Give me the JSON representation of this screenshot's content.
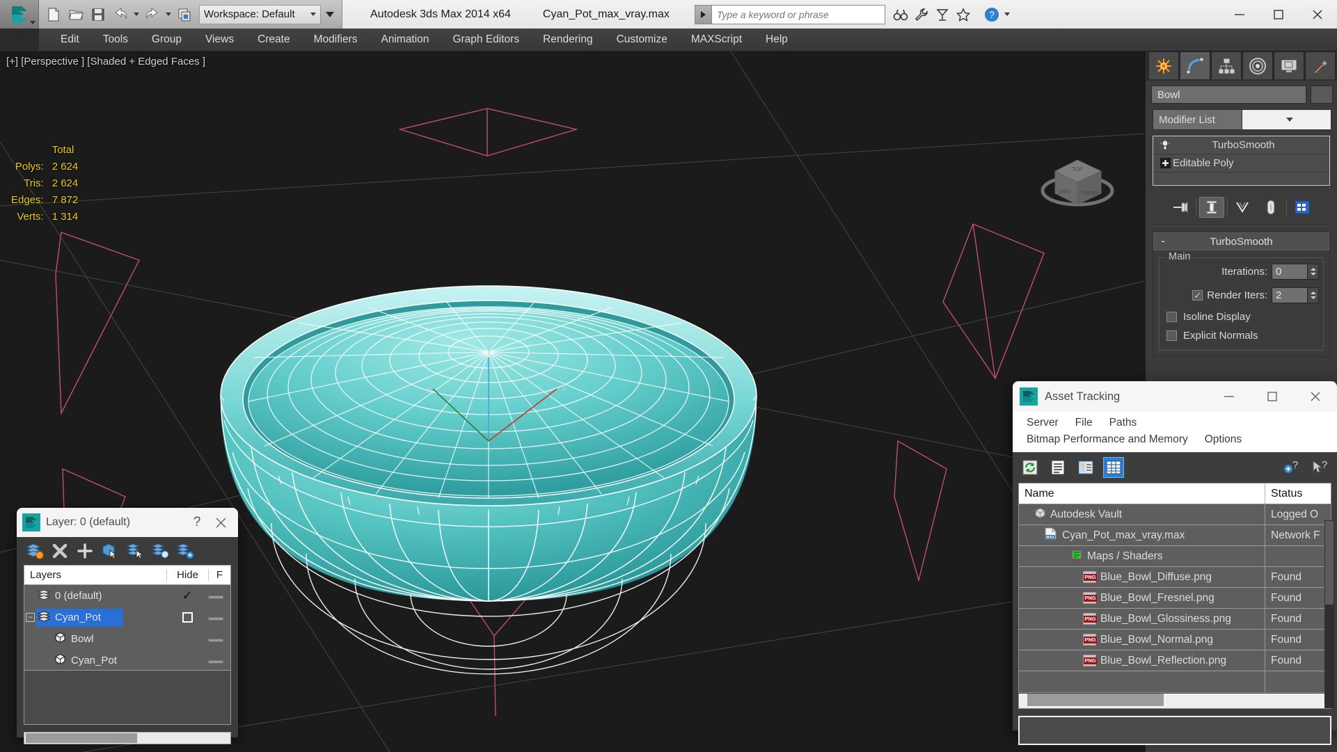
{
  "app": {
    "title": "Autodesk 3ds Max  2014 x64",
    "file_title": "Cyan_Pot_max_vray.max",
    "workspace_label": "Workspace: Default",
    "search_placeholder": "Type a keyword or phrase"
  },
  "quick_access": [
    {
      "name": "new-file-icon",
      "label": "New"
    },
    {
      "name": "open-file-icon",
      "label": "Open"
    },
    {
      "name": "save-file-icon",
      "label": "Save"
    },
    {
      "name": "undo-icon",
      "label": "Undo"
    },
    {
      "name": "redo-icon",
      "label": "Redo"
    },
    {
      "name": "project-folder-icon",
      "label": "Set Project Folder"
    }
  ],
  "window_buttons": {
    "minimize": "—",
    "maximize": "□",
    "close": "✕"
  },
  "menu": {
    "items": [
      {
        "label": "Edit"
      },
      {
        "label": "Tools"
      },
      {
        "label": "Group"
      },
      {
        "label": "Views"
      },
      {
        "label": "Create"
      },
      {
        "label": "Modifiers"
      },
      {
        "label": "Animation"
      },
      {
        "label": "Graph Editors"
      },
      {
        "label": "Rendering"
      },
      {
        "label": "Customize"
      },
      {
        "label": "MAXScript"
      },
      {
        "label": "Help"
      }
    ]
  },
  "viewport": {
    "label": "[+] [Perspective ] [Shaded + Edged Faces ]",
    "stats": {
      "header": "Total",
      "rows": [
        {
          "label": "Polys:",
          "value": "2 624"
        },
        {
          "label": "Tris:",
          "value": "2 624"
        },
        {
          "label": "Edges:",
          "value": "7 872"
        },
        {
          "label": "Verts:",
          "value": "1 314"
        }
      ]
    },
    "object_color": "#4fc6c6",
    "wire_color": "#ffffff",
    "grid_color": "#e2577f",
    "background": "#1b1b1b"
  },
  "command_panel": {
    "tabs": [
      {
        "name": "create-tab",
        "label": "Create"
      },
      {
        "name": "modify-tab",
        "label": "Modify",
        "active": true
      },
      {
        "name": "hierarchy-tab",
        "label": "Hierarchy"
      },
      {
        "name": "motion-tab",
        "label": "Motion"
      },
      {
        "name": "display-tab",
        "label": "Display"
      },
      {
        "name": "utilities-tab",
        "label": "Utilities"
      }
    ],
    "object_name": "Bowl",
    "modifier_list_label": "Modifier List",
    "stack": [
      {
        "label": "TurboSmooth",
        "icon": "lightbulb-icon",
        "selected": true
      },
      {
        "label": "Editable Poly",
        "icon": "plus-box-icon",
        "selected": false
      }
    ],
    "rollout": {
      "title": "TurboSmooth",
      "minus": "-",
      "group_label": "Main",
      "iterations_label": "Iterations:",
      "iterations_value": "0",
      "render_iters_label": "Render Iters:",
      "render_iters_value": "2",
      "render_iters_checked": true,
      "isoline_label": "Isoline Display",
      "isoline_checked": false,
      "explicit_label": "Explicit Normals",
      "explicit_checked": false
    }
  },
  "layer_dialog": {
    "title": "Layer: 0 (default)",
    "help_glyph": "?",
    "close_glyph": "✕",
    "toolbar": [
      {
        "name": "new-layer-icon"
      },
      {
        "name": "delete-layer-icon"
      },
      {
        "name": "add-layer-icon"
      },
      {
        "name": "select-objects-icon"
      },
      {
        "name": "select-highlighted-icon"
      },
      {
        "name": "highlight-selected-icon"
      },
      {
        "name": "layer-settings-icon"
      }
    ],
    "columns": [
      "Layers",
      "",
      "Hide",
      "F"
    ],
    "rows": [
      {
        "name": "0 (default)",
        "indent": 0,
        "icon": "layer-icon",
        "hide": "✓",
        "freeze": "▬",
        "selected": false,
        "expander": ""
      },
      {
        "name": "Cyan_Pot",
        "indent": 0,
        "icon": "layer-icon",
        "hide": "□",
        "freeze": "▬",
        "selected": true,
        "expander": "–"
      },
      {
        "name": "Bowl",
        "indent": 1,
        "icon": "object-box-icon",
        "hide": "",
        "freeze": "▬",
        "selected": false,
        "expander": ""
      },
      {
        "name": "Cyan_Pot",
        "indent": 1,
        "icon": "object-box-icon",
        "hide": "",
        "freeze": "▬",
        "selected": false,
        "expander": ""
      }
    ]
  },
  "asset_tracking": {
    "title": "Asset Tracking",
    "window_buttons": {
      "minimize": "—",
      "maximize": "□",
      "close": "✕"
    },
    "menus_row1": [
      "Server",
      "File",
      "Paths"
    ],
    "menus_row2": [
      "Bitmap Performance and Memory",
      "Options"
    ],
    "toolbar": [
      {
        "name": "refresh-icon",
        "active": false
      },
      {
        "name": "list-view-icon",
        "active": false
      },
      {
        "name": "detail-view-icon",
        "active": false
      },
      {
        "name": "grid-view-icon",
        "active": true
      }
    ],
    "toolbar_right": [
      {
        "name": "add-help-icon"
      },
      {
        "name": "context-help-icon"
      }
    ],
    "columns": [
      "Name",
      "Status"
    ],
    "rows": [
      {
        "name": "Autodesk Vault",
        "status": "Logged O",
        "indent": 0,
        "icon": "vault-icon"
      },
      {
        "name": "Cyan_Pot_max_vray.max",
        "status": "Network F",
        "indent": 1,
        "icon": "max-file-icon"
      },
      {
        "name": "Maps / Shaders",
        "status": "",
        "indent": 2,
        "icon": "maps-icon"
      },
      {
        "name": "Blue_Bowl_Diffuse.png",
        "status": "Found",
        "indent": 3,
        "icon": "png-icon"
      },
      {
        "name": "Blue_Bowl_Fresnel.png",
        "status": "Found",
        "indent": 3,
        "icon": "png-icon"
      },
      {
        "name": "Blue_Bowl_Glossiness.png",
        "status": "Found",
        "indent": 3,
        "icon": "png-icon"
      },
      {
        "name": "Blue_Bowl_Normal.png",
        "status": "Found",
        "indent": 3,
        "icon": "png-icon"
      },
      {
        "name": "Blue_Bowl_Reflection.png",
        "status": "Found",
        "indent": 3,
        "icon": "png-icon"
      },
      {
        "name": "",
        "status": "",
        "indent": 0,
        "icon": ""
      }
    ]
  }
}
